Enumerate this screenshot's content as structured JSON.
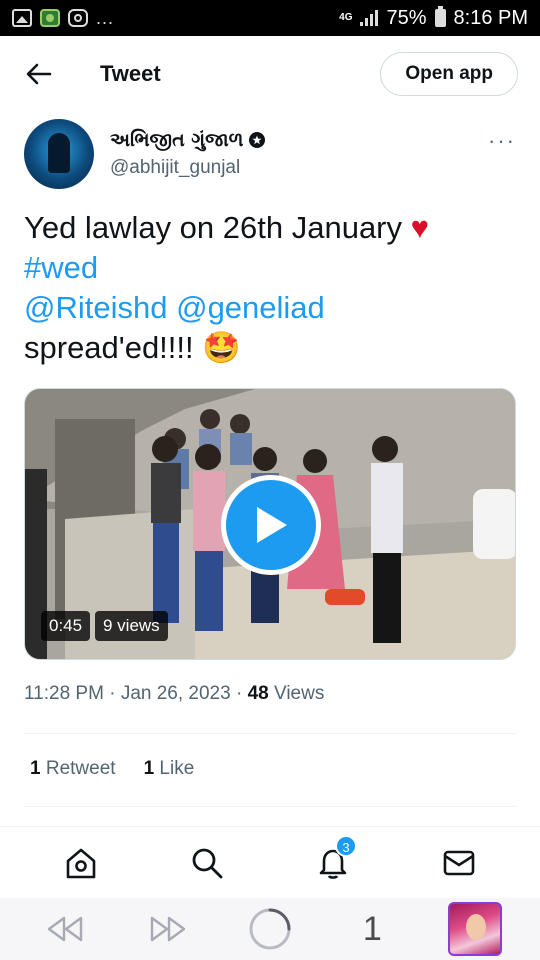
{
  "status_bar": {
    "dots": "...",
    "network": "4G",
    "battery": "75%",
    "time": "8:16 PM"
  },
  "header": {
    "title": "Tweet",
    "open_app_label": "Open app"
  },
  "author": {
    "name": "અભિજીત ગુંજાળ",
    "handle": "@abhijit_gunjal",
    "more": "···"
  },
  "tweet": {
    "line1": "Yed lawlay on 26th January ",
    "heart": "♥",
    "hashtag": "#wed",
    "mention1": "@Riteishd",
    "mention2": "@geneliad",
    "line4": "spread'ed!!!! ",
    "emoji": "🤩"
  },
  "video": {
    "duration": "0:45",
    "views": "9 views"
  },
  "meta": {
    "time": "11:28 PM",
    "sep": "·",
    "date": "Jan 26, 2023",
    "view_count": "48",
    "views_label": "Views"
  },
  "stats": {
    "retweets_count": "1",
    "retweets_label": "Retweet",
    "likes_count": "1",
    "likes_label": "Like"
  },
  "bottom_nav": {
    "notifications_badge": "3"
  },
  "browser_bar": {
    "tab_count": "1"
  },
  "colors": {
    "accent": "#1d9bf0",
    "text": "#0f1419",
    "muted": "#536471",
    "heart": "#d9102a"
  }
}
